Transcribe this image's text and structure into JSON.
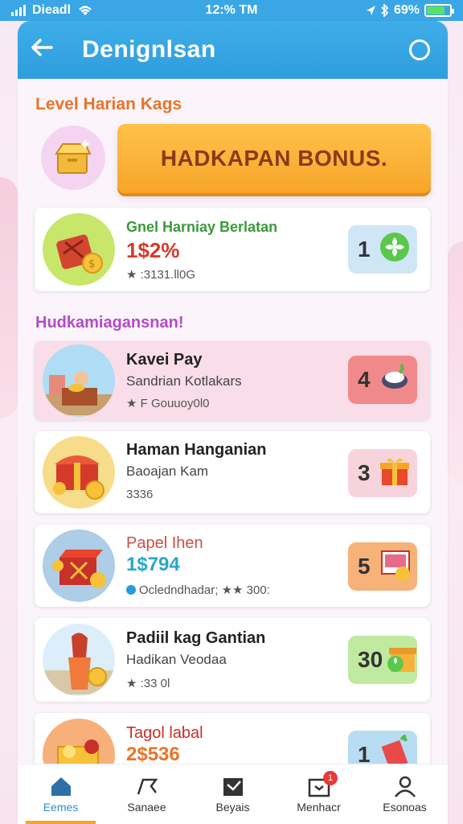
{
  "status_bar": {
    "carrier": "Dieadl",
    "time": "12:% TM",
    "battery_text": "69%"
  },
  "header": {
    "title": "Denignlsan"
  },
  "level_section": {
    "title": "Level Harian Kags",
    "bonus_button": "HADKAPAN BONUS."
  },
  "featured": {
    "name": "Gnel Harniay Berlatan",
    "value": "1$2%",
    "meta": "★ :3131.ll0G",
    "badge_number": "1"
  },
  "list_section": {
    "title": "Hudkamiagansnan!"
  },
  "items": [
    {
      "name": "Kavei Pay",
      "sub": "Sandrian Kotlakars",
      "meta": "★ F Gouuoy0l0",
      "badge_number": "4"
    },
    {
      "name": "Haman Hanganian",
      "sub": "Baoajan Kam",
      "meta": "3336",
      "badge_number": "3"
    },
    {
      "name": "Papel Ihen",
      "sub": "1$794",
      "meta": "Ocledndhadar; ★★ 300:",
      "badge_number": "5"
    },
    {
      "name": "Padiil kag Gantian",
      "sub": "Hadikan Veodaa",
      "meta": "★ :33 0l",
      "badge_number": "30"
    },
    {
      "name": "Tagol labal",
      "sub": "2$536",
      "meta": "",
      "badge_number": "1"
    }
  ],
  "nav": [
    {
      "label": "Eemes",
      "icon": "home-icon"
    },
    {
      "label": "Sanaee",
      "icon": "pen-icon"
    },
    {
      "label": "Beyais",
      "icon": "inbox-icon"
    },
    {
      "label": "Menhacr",
      "icon": "notification-icon",
      "badge": "1"
    },
    {
      "label": "Esonoas",
      "icon": "profile-icon"
    }
  ],
  "colors": {
    "header": "#3aa6e6",
    "bonus": "#f7a52a",
    "accent_orange": "#e8742a",
    "accent_purple": "#b44ac8"
  }
}
